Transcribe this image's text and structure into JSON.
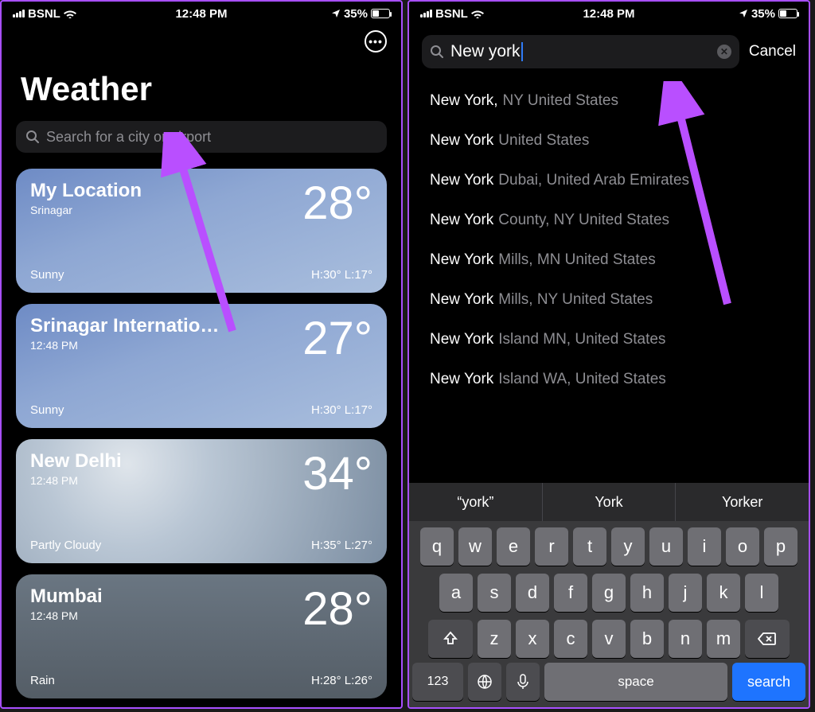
{
  "status": {
    "carrier": "BSNL",
    "time": "12:48 PM",
    "battery_pct": "35%"
  },
  "left": {
    "title": "Weather",
    "search_placeholder": "Search for a city or airport",
    "cards": [
      {
        "name": "My Location",
        "sub": "Srinagar",
        "temp": "28°",
        "cond": "Sunny",
        "hilo": "H:30°  L:17°",
        "style": "sunny"
      },
      {
        "name": "Srinagar Internatio…",
        "sub": "12:48 PM",
        "temp": "27°",
        "cond": "Sunny",
        "hilo": "H:30°  L:17°",
        "style": "sunny"
      },
      {
        "name": "New Delhi",
        "sub": "12:48 PM",
        "temp": "34°",
        "cond": "Partly Cloudy",
        "hilo": "H:35°  L:27°",
        "style": "cloudy"
      },
      {
        "name": "Mumbai",
        "sub": "12:48 PM",
        "temp": "28°",
        "cond": "Rain",
        "hilo": "H:28°  L:26°",
        "style": "rain"
      }
    ]
  },
  "right": {
    "query": "New york",
    "cancel": "Cancel",
    "results": [
      {
        "primary": "New York,",
        "secondary": "NY United States"
      },
      {
        "primary": "New York",
        "secondary": "United States"
      },
      {
        "primary": "New York",
        "secondary": "Dubai, United Arab Emirates"
      },
      {
        "primary": "New York",
        "secondary": "County, NY United States"
      },
      {
        "primary": "New York",
        "secondary": "Mills, MN United States"
      },
      {
        "primary": "New York",
        "secondary": "Mills, NY United States"
      },
      {
        "primary": "New York",
        "secondary": "Island MN, United States"
      },
      {
        "primary": "New York",
        "secondary": "Island WA, United States"
      }
    ],
    "suggestions": [
      "“york”",
      "York",
      "Yorker"
    ],
    "keyboard": {
      "row1": [
        "q",
        "w",
        "e",
        "r",
        "t",
        "y",
        "u",
        "i",
        "o",
        "p"
      ],
      "row2": [
        "a",
        "s",
        "d",
        "f",
        "g",
        "h",
        "j",
        "k",
        "l"
      ],
      "row3": [
        "z",
        "x",
        "c",
        "v",
        "b",
        "n",
        "m"
      ],
      "num": "123",
      "space": "space",
      "search": "search"
    }
  }
}
